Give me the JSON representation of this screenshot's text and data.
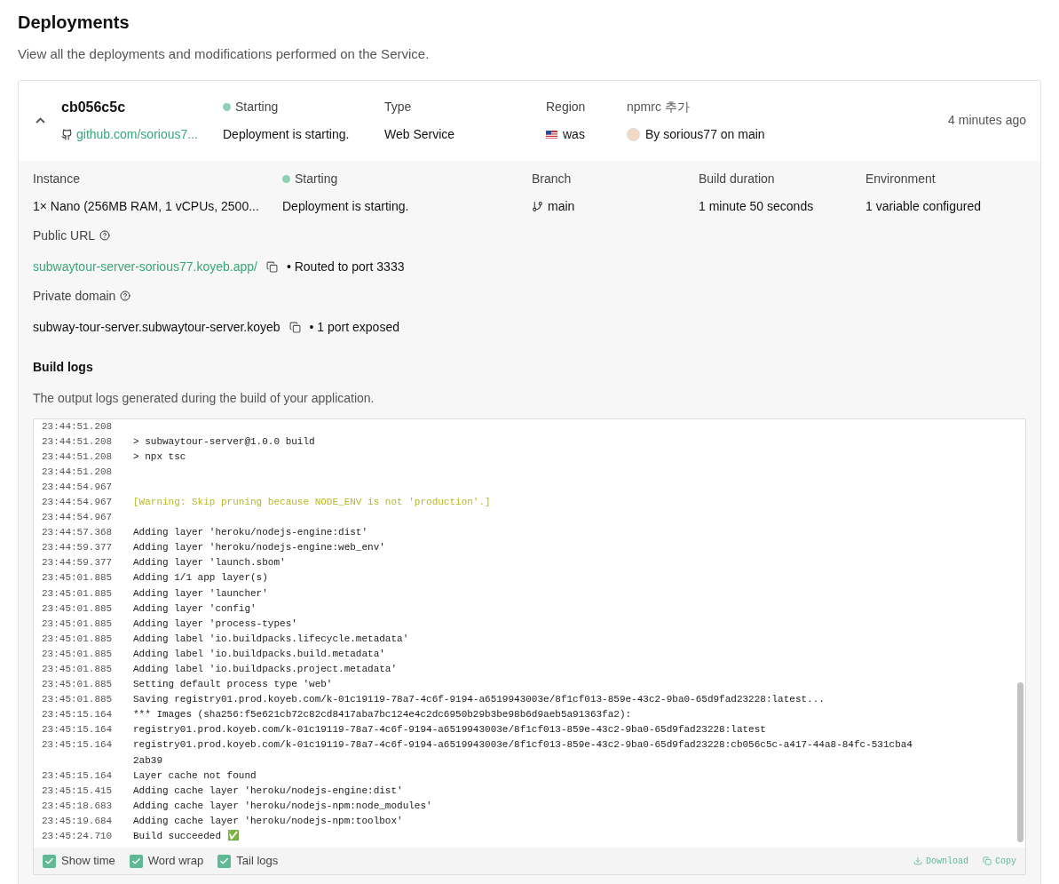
{
  "page": {
    "title": "Deployments",
    "subtitle": "View all the deployments and modifications performed on the Service."
  },
  "deployment": {
    "expanded": true,
    "id": "cb056c5c",
    "repo": "github.com/sorious7...",
    "status": {
      "label": "Starting",
      "detail": "Deployment is starting."
    },
    "type": {
      "label": "Type",
      "value": "Web Service"
    },
    "region": {
      "label": "Region",
      "value": "was"
    },
    "commit": {
      "message": "npmrc 추가",
      "author": "By sorious77 on main"
    },
    "time": "4 minutes ago"
  },
  "details": {
    "instance": {
      "label": "Instance",
      "value": "1× Nano (256MB RAM, 1 vCPUs, 2500..."
    },
    "status": {
      "label": "Starting",
      "detail": "Deployment is starting."
    },
    "branch": {
      "label": "Branch",
      "value": "main"
    },
    "build_duration": {
      "label": "Build duration",
      "value": "1 minute 50 seconds"
    },
    "environment": {
      "label": "Environment",
      "value": "1 variable configured"
    },
    "public_url": {
      "label": "Public URL",
      "value": "subwaytour-server-sorious77.koyeb.app/",
      "note": "• Routed to port 3333"
    },
    "private_domain": {
      "label": "Private domain",
      "value": "subway-tour-server.subwaytour-server.koyeb",
      "note": "• 1 port exposed"
    }
  },
  "build_logs": {
    "title": "Build logs",
    "description": "The output logs generated during the build of your application.",
    "lines": [
      {
        "time": "23:44:51.208"
      },
      {
        "time": "23:44:51.208",
        "message": "> subwaytour-server@1.0.0 build",
        "kind": "normal"
      },
      {
        "time": "23:44:51.208",
        "message": "> npx tsc",
        "kind": "normal"
      },
      {
        "time": "23:44:51.208"
      },
      {
        "time": "23:44:54.967"
      },
      {
        "time": "23:44:54.967",
        "message": "[Warning: Skip pruning because NODE_ENV is not 'production'.]",
        "kind": "warning"
      },
      {
        "time": "23:44:54.967"
      },
      {
        "time": "23:44:57.368",
        "message": "Adding layer 'heroku/nodejs-engine:dist'",
        "kind": "normal"
      },
      {
        "time": "23:44:59.377",
        "message": "Adding layer 'heroku/nodejs-engine:web_env'",
        "kind": "normal"
      },
      {
        "time": "23:44:59.377",
        "message": "Adding layer 'launch.sbom'",
        "kind": "normal"
      },
      {
        "time": "23:45:01.885",
        "message": "Adding 1/1 app layer(s)",
        "kind": "normal"
      },
      {
        "time": "23:45:01.885",
        "message": "Adding layer 'launcher'",
        "kind": "normal"
      },
      {
        "time": "23:45:01.885",
        "message": "Adding layer 'config'",
        "kind": "normal"
      },
      {
        "time": "23:45:01.885",
        "message": "Adding layer 'process-types'",
        "kind": "normal"
      },
      {
        "time": "23:45:01.885",
        "message": "Adding label 'io.buildpacks.lifecycle.metadata'",
        "kind": "normal"
      },
      {
        "time": "23:45:01.885",
        "message": "Adding label 'io.buildpacks.build.metadata'",
        "kind": "normal"
      },
      {
        "time": "23:45:01.885",
        "message": "Adding label 'io.buildpacks.project.metadata'",
        "kind": "normal"
      },
      {
        "time": "23:45:01.885",
        "message": "Setting default process type 'web'",
        "kind": "normal"
      },
      {
        "time": "23:45:01.885",
        "message": "Saving registry01.prod.koyeb.com/k-01c19119-78a7-4c6f-9194-a6519943003e/8f1cf013-859e-43c2-9ba0-65d9fad23228:latest...",
        "kind": "normal"
      },
      {
        "time": "23:45:15.164",
        "message": "*** Images (sha256:f5e621cb72c82cd8417aba7bc124e4c2dc6950b29b3be98b6d9aeb5a91363fa2):",
        "kind": "normal"
      },
      {
        "time": "23:45:15.164",
        "message": "registry01.prod.koyeb.com/k-01c19119-78a7-4c6f-9194-a6519943003e/8f1cf013-859e-43c2-9ba0-65d9fad23228:latest",
        "kind": "normal"
      },
      {
        "time": "23:45:15.164",
        "message": "registry01.prod.koyeb.com/k-01c19119-78a7-4c6f-9194-a6519943003e/8f1cf013-859e-43c2-9ba0-65d9fad23228:cb056c5c-a417-44a8-84fc-531cba42ab39",
        "kind": "normal"
      },
      {
        "time": "23:45:15.164",
        "message": "Layer cache not found",
        "kind": "normal"
      },
      {
        "time": "23:45:15.415",
        "message": "Adding cache layer 'heroku/nodejs-engine:dist'",
        "kind": "normal"
      },
      {
        "time": "23:45:18.683",
        "message": "Adding cache layer 'heroku/nodejs-npm:node_modules'",
        "kind": "normal"
      },
      {
        "time": "23:45:19.684",
        "message": "Adding cache layer 'heroku/nodejs-npm:toolbox'",
        "kind": "normal"
      },
      {
        "time": "23:45:24.710",
        "message": "Build succeeded ✅",
        "kind": "normal"
      }
    ],
    "options": [
      {
        "label": "Show time",
        "checked": true
      },
      {
        "label": "Word wrap",
        "checked": true
      },
      {
        "label": "Tail logs",
        "checked": true
      }
    ],
    "actions": {
      "download": "Download",
      "copy": "Copy"
    }
  }
}
